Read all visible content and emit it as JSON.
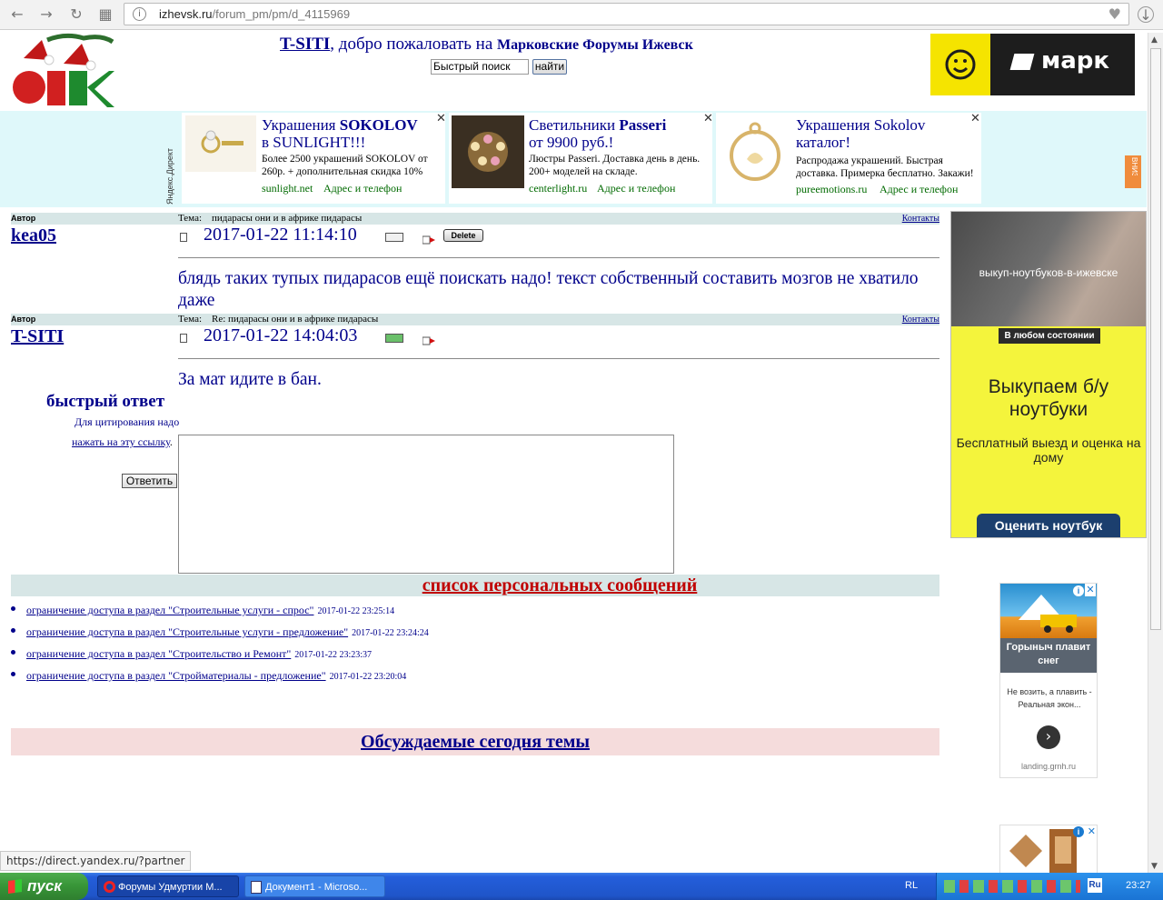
{
  "browser": {
    "url_host": "izhevsk.ru",
    "url_path": "/forum_pm/pm/d_4115969"
  },
  "header": {
    "user": "T-SITI",
    "welcome_text": ", добро пожаловать на ",
    "forum_name": "Марковские Форумы Ижевск",
    "search_value": "Быстрый поиск",
    "search_button": "найти",
    "ad_brand": "марк"
  },
  "direct": {
    "label": "Яндекс.Директ",
    "ads": [
      {
        "title_1": "Украшения ",
        "title_brand": "SOKOLOV",
        "title_2": "в SUNLIGHT!!!",
        "text": "Более 2500 украшений SOKOLOV от 260р. + дополнительная скидка 10%",
        "domain": "sunlight.net",
        "contact": "Адрес и телефон"
      },
      {
        "title_1": "Светильники ",
        "title_brand": "Passeri",
        "title_2": "от 9900 руб.!",
        "text": "Люстры Passeri. Доставка день в день. 200+ моделей на складе.",
        "domain": "centerlight.ru",
        "contact": "Адрес и телефон"
      },
      {
        "title_1": "Украшения Sokolov",
        "title_brand": "",
        "title_2": "каталог!",
        "text": "Распродажа украшений. Быстрая доставка. Примерка бесплатно. Закажи!",
        "domain": "pureemotions.ru",
        "contact": "Адрес и телефон"
      }
    ],
    "vniz": "ВНИЗ"
  },
  "posts": [
    {
      "author_label": "Автор",
      "topic_label": "Тема:",
      "topic": "пидарасы они и в африке пидарасы",
      "contacts": "Контакты",
      "author": "kea05",
      "date": "2017-01-22 11:14:10",
      "delete": "Delete",
      "body": "блядь таких тупых пидарасов ещё поискать надо! текст собственный составить мозгов не хватило даже"
    },
    {
      "author_label": "Автор",
      "topic_label": "Тема:",
      "topic": "Re: пидарасы они и в африке пидарасы",
      "contacts": "Контакты",
      "author": "T-SITI",
      "date": "2017-01-22 14:04:03",
      "body": "За мат идите в бан."
    }
  ],
  "quick_reply": {
    "title": "быстрый ответ",
    "hint": "Для цитирования надо",
    "link": "нажать на эту ссылку",
    "link_suffix": ".",
    "button": "Ответить"
  },
  "pm_list": {
    "title": "список персональных сообщений",
    "items": [
      {
        "text": "ограничение доступа в раздел \"Строительные услуги - спрос\"",
        "date": "2017-01-22 23:25:14"
      },
      {
        "text": "ограничение доступа в раздел \"Строительные услуги - предложение\"",
        "date": "2017-01-22 23:24:24"
      },
      {
        "text": "ограничение доступа в раздел \"Строительство и Ремонт\"",
        "date": "2017-01-22 23:23:37"
      },
      {
        "text": "ограничение доступа в раздел \"Стройматериалы - предложение\"",
        "date": "2017-01-22 23:20:04"
      }
    ]
  },
  "today": {
    "title": "Обсуждаемые сегодня темы"
  },
  "side_ads": {
    "ad1": {
      "photo_text": "выкуп-ноутбуков-в-ижевске",
      "badge": "В любом состоянии",
      "headline": "Выкупаем б/у ноутбуки",
      "sub": "Бесплатный выезд и оценка на дому",
      "button": "Оценить ноутбук"
    },
    "ad2": {
      "headline": "Горыныч плавит снег",
      "text": "Не возить, а плавить - Реальная экон...",
      "domain": "landing.grnh.ru"
    }
  },
  "statusbar": "https://direct.yandex.ru/?partner",
  "taskbar": {
    "start": "пуск",
    "tasks": [
      "Форумы Удмуртии М...",
      "Документ1 - Microso..."
    ],
    "lang": "RL",
    "time": "23:27"
  },
  "colors": {
    "link": "#00008b",
    "accent_red": "#c00000",
    "header_bar": "#d7e6e6",
    "direct_bg": "#dff8fa"
  }
}
